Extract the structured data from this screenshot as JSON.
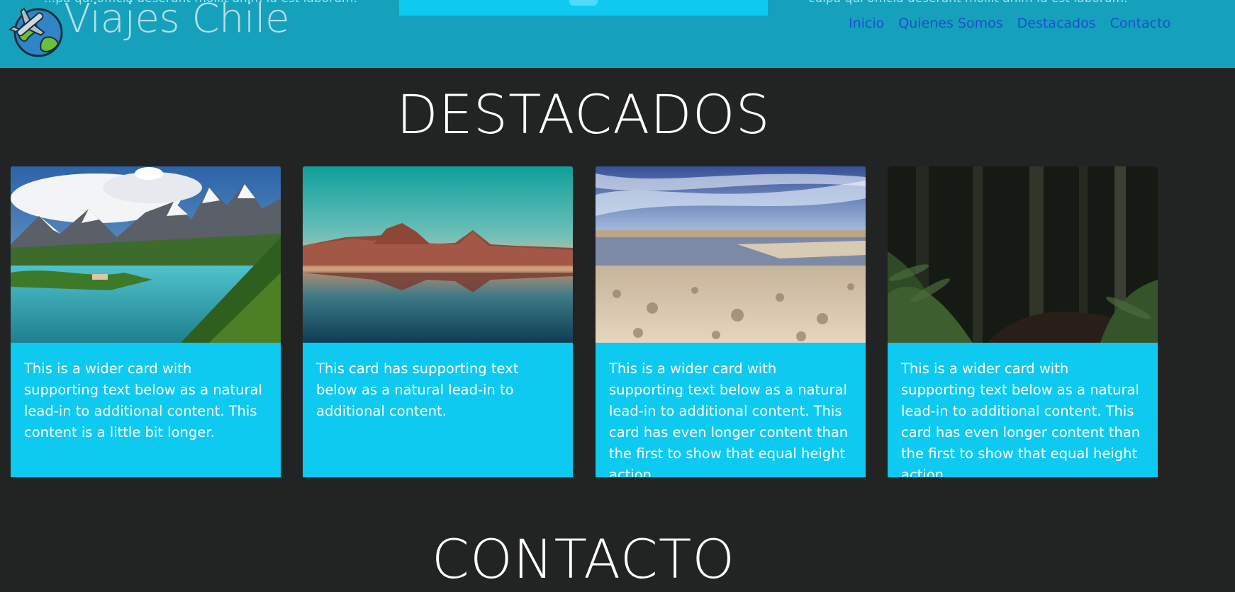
{
  "header": {
    "brand": "Viajes Chile",
    "clipped_left_text": "...pa qui officia deserunt mollit anim id est laborum.",
    "clipped_right_text": "culpa qui officia deserunt mollit anim id est laborum.",
    "nav": [
      "Inicio",
      "Quienes Somos",
      "Destacados",
      "Contacto"
    ]
  },
  "sections": {
    "destacados_title": "DESTACADOS",
    "contacto_title": "CONTACTO"
  },
  "cards": [
    {
      "image": "torres-del-paine-landscape",
      "text": "This is a wider card with supporting text below as a natural lead-in to additional content. This content is a little bit longer."
    },
    {
      "image": "volcano-lake-reflection",
      "text": "This card has supporting text below as a natural lead-in to additional content."
    },
    {
      "image": "salt-flat-lagoon",
      "text": "This is a wider card with supporting text below as a natural lead-in to additional content. This card has even longer content than the first to show that equal height action."
    },
    {
      "image": "forest-fern-path",
      "text": "This is a wider card with supporting text below as a natural lead-in to additional content. This card has even longer content than the first to show that equal height action."
    }
  ],
  "colors": {
    "header_bg": "#15a1bb",
    "page_bg": "#222423",
    "card_bg": "#0ec9f0",
    "nav_link": "#1d4fcf"
  }
}
